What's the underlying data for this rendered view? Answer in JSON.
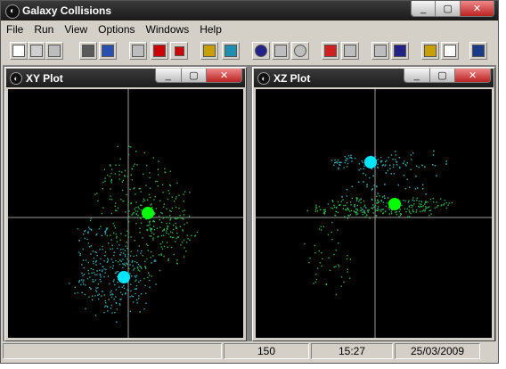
{
  "window": {
    "title": "Galaxy Collisions",
    "caption_buttons": [
      "_",
      "▢",
      "✕"
    ]
  },
  "menu": [
    "File",
    "Run",
    "View",
    "Options",
    "Windows",
    "Help"
  ],
  "toolbar": [
    {
      "name": "new-icon",
      "color": "#ffffff"
    },
    {
      "name": "open-icon",
      "color": "#cfcfcf"
    },
    {
      "name": "save-icon",
      "color": "#bdbdbd"
    },
    {
      "name": "print-icon",
      "color": "#5a5a5a"
    },
    {
      "name": "print-preview-icon",
      "color": "#2b4fb0"
    },
    {
      "name": "blank-icon",
      "color": "#bdbdbd"
    },
    {
      "name": "fast-forward-icon",
      "color": "#cc0000"
    },
    {
      "name": "stop-icon",
      "color": "#cc0000"
    },
    {
      "name": "clipboard-icon",
      "color": "#c8a000"
    },
    {
      "name": "eye-icon",
      "color": "#1f8fb0"
    },
    {
      "name": "zoom-out-icon",
      "color": "#222288"
    },
    {
      "name": "square-icon",
      "color": "#bdbdbd"
    },
    {
      "name": "target-icon",
      "color": "#bdbdbd"
    },
    {
      "name": "colors-icon",
      "color": "#d02020"
    },
    {
      "name": "grid-icon",
      "color": "#bdbdbd"
    },
    {
      "name": "tile-icon",
      "color": "#bdbdbd"
    },
    {
      "name": "cascade-icon",
      "color": "#222288"
    },
    {
      "name": "help-icon",
      "color": "#c8a000"
    },
    {
      "name": "speech-icon",
      "color": "#ffffff"
    },
    {
      "name": "exit-icon",
      "color": "#1a3a8a"
    }
  ],
  "children": [
    {
      "title": "XY Plot",
      "buttons": [
        "_",
        "▢",
        "✕"
      ],
      "axis_color": "#9a9a9a",
      "center_a_color": "#00ff00",
      "center_b_color": "#00e5ff"
    },
    {
      "title": "XZ Plot",
      "buttons": [
        "_",
        "▢",
        "✕"
      ],
      "axis_color": "#9a9a9a",
      "center_a_color": "#00ff00",
      "center_b_color": "#00e5ff"
    }
  ],
  "status": {
    "step": "150",
    "time": "15:27",
    "date": "25/03/2009"
  }
}
